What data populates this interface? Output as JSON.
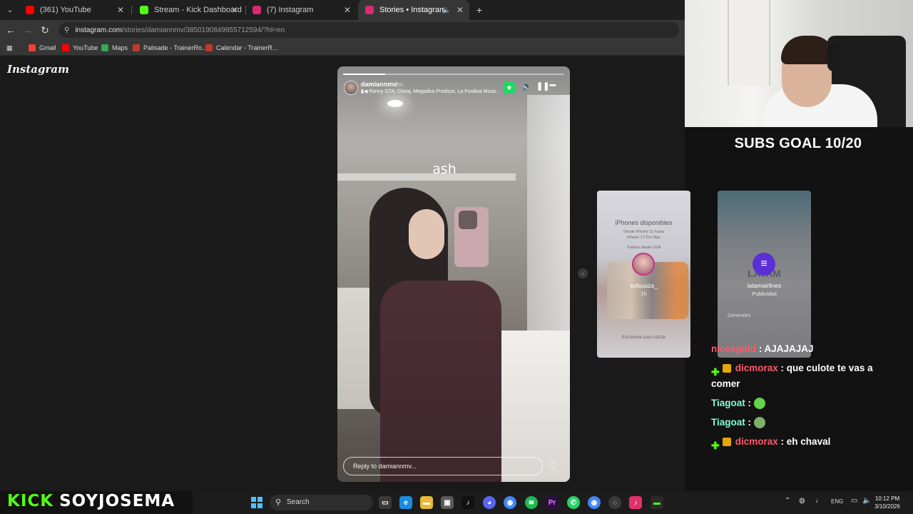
{
  "browser": {
    "tabs": [
      {
        "title": "(361) YouTube",
        "color": "#ff0000"
      },
      {
        "title": "Stream - Kick Dashboard",
        "color": "#53fc18"
      },
      {
        "title": "(7) Instagram",
        "color": "#d62976"
      },
      {
        "title": "Stories • Instagram",
        "color": "#d62976",
        "active": true
      }
    ],
    "address": {
      "host": "instagram.com",
      "path": "/stories/damiannmv/3850190849955712594/?hl=en"
    },
    "bookmarks": [
      {
        "label": "Gmail",
        "color": "#ea4335"
      },
      {
        "label": "YouTube",
        "color": "#ff0000"
      },
      {
        "label": "Maps",
        "color": "#34a853"
      },
      {
        "label": "Palisade - TrainerRo...",
        "color": "#c0392b"
      },
      {
        "label": "Calendar - TrainerR...",
        "color": "#c0392b"
      }
    ]
  },
  "instagram": {
    "logo": "Instagram",
    "story": {
      "username": "damiannmv",
      "time": "3m",
      "music": "Ronny GTA, Cheiq, Megadivo Produce, La Positiva Music ·",
      "caption": "ash",
      "progress": 0.19,
      "reply_placeholder": "Reply to damiannmv..."
    },
    "previews": [
      {
        "name": "sofsuaza_",
        "sub": "1h",
        "title": "iPhones disponibles",
        "line1": "Desde iPhone 11 hasta",
        "line2": "iPhone 17 Pro Max",
        "line3": "Traídos desde USA",
        "footer": "Escríbeme para cotizar"
      },
      {
        "name": "latamairlines",
        "sub": "Publicidad",
        "logo_text": "LATAM",
        "bottom_text": "Generales"
      }
    ]
  },
  "stream": {
    "subs_goal": "SUBS GOAL 10/20",
    "kick_label": "KICK",
    "channel": "SOYJOSEMA",
    "chat": [
      {
        "user": "niceegold",
        "color": "#ff5a6a",
        "text": "AJAJAJAJ",
        "badges": []
      },
      {
        "user": "dicmorax",
        "color": "#ff5a6a",
        "text": "que culote te vas a comer",
        "badges": [
          "plus",
          "crown"
        ]
      },
      {
        "user": "Tiagoat",
        "color": "#7fffd4",
        "text": "",
        "badges": [],
        "emote": "#65d24b"
      },
      {
        "user": "Tiagoat",
        "color": "#7fffd4",
        "text": "",
        "badges": [],
        "emote": "#7fb069"
      },
      {
        "user": "dicmorax",
        "color": "#ff5a6a",
        "text": "eh chaval",
        "badges": [
          "plus",
          "crown"
        ]
      }
    ]
  },
  "taskbar": {
    "search": "Search",
    "lang": "ENG",
    "time": "10:12 PM",
    "date": "3/10/2026"
  }
}
